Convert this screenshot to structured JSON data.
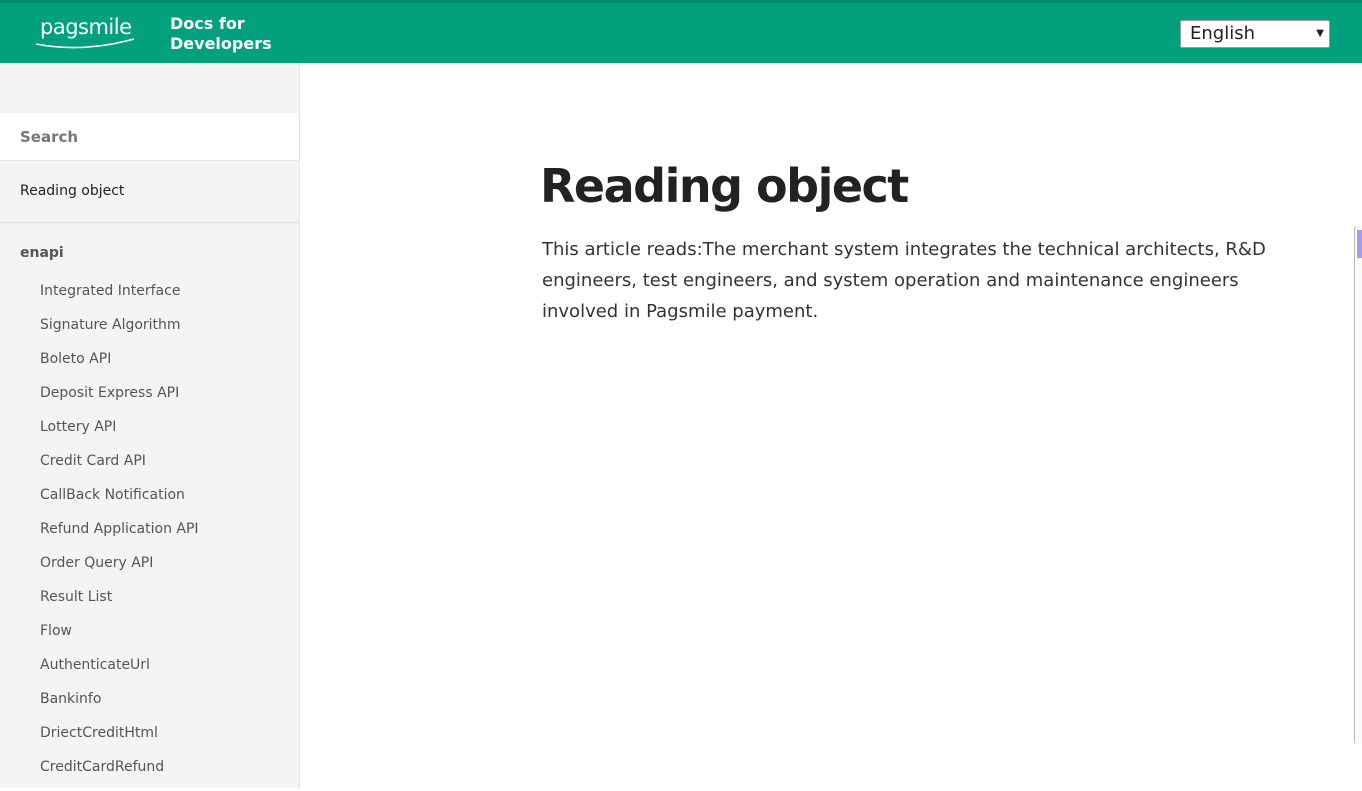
{
  "header": {
    "logo_text": "pagsmile",
    "site_title": "Docs for Developers",
    "language": {
      "selected": "English"
    }
  },
  "sidebar": {
    "search": {
      "placeholder": "Search",
      "value": ""
    },
    "top_item": "Reading object",
    "group": {
      "label": "enapi",
      "items": [
        "Integrated Interface",
        "Signature Algorithm",
        "Boleto API",
        "Deposit Express API",
        "Lottery API",
        "Credit Card API",
        "CallBack Notification",
        "Refund Application API",
        "Order Query API",
        "Result List",
        "Flow",
        "AuthenticateUrl",
        "Bankinfo",
        "DriectCreditHtml",
        "CreditCardRefund"
      ]
    }
  },
  "main": {
    "title": "Reading object",
    "body": "This article reads:The merchant system integrates the technical architects, R&D engineers, test engineers, and system operation and maintenance engineers involved in Pagsmile payment."
  },
  "colors": {
    "header_bg": "#03a07e",
    "sidebar_bg": "#f4f4f4",
    "text_primary": "#222222"
  }
}
